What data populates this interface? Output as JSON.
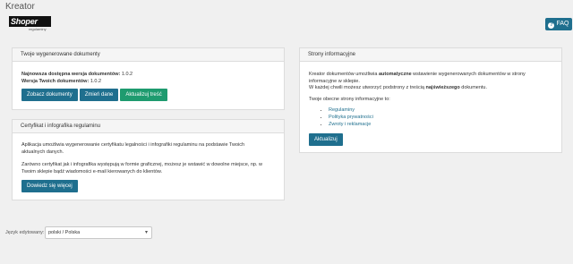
{
  "app_title": "Kreator",
  "logo": {
    "brand": "Shoper",
    "sub": "regulaminy"
  },
  "faq": {
    "label": "FAQ"
  },
  "documents_panel": {
    "title": "Twoje wygenerowane dokumenty",
    "latest_label": "Najnowsza dostępna wersja dokumentów:",
    "latest_value": "1.0.2",
    "yours_label": "Wersja Twoich dokumentów:",
    "yours_value": "1.0.2",
    "buttons": [
      "Zobacz dokumenty",
      "Zmień dane",
      "Aktualizuj treść"
    ]
  },
  "certificate_panel": {
    "title": "Certyfikat i infografika regulaminu",
    "para1": "Aplikacja umożliwia wygenerowanie certyfikatu legalności i infografiki regulaminu na podstawie Twoich aktualnych danych.",
    "para2": "Zarówno certyfikat jak i infografika występują w formie graficznej, możesz je wstawić w dowolne miejsce, np. w Twoim sklepie bądź wiadomości e-mail kierowanych do klientów.",
    "button": "Dowiedz się więcej"
  },
  "info_pages_panel": {
    "title": "Strony informacyjne",
    "p1_before": "Kreator dokumentów umożliwia ",
    "p1_bold": "automatyczne",
    "p1_after": " wstawienie wygenerowanych dokumentów w strony informacyjne w sklepie.",
    "p2_before": "W każdej chwili możesz utworzyć podstrony z treścią ",
    "p2_bold": "najświeższego",
    "p2_after": " dokumentu.",
    "list_intro": "Twoje obecne strony informacyjne to:",
    "pages": [
      "Regulaminy",
      "Polityka prywatności",
      "Zwroty i reklamacje"
    ],
    "button": "Aktualizuj"
  },
  "language": {
    "label": "Język edytowany:",
    "selected": "polski / Polska"
  },
  "colors": {
    "primary": "#1f6f8e",
    "success": "#1e9b6f",
    "background": "#f0f0f0"
  }
}
